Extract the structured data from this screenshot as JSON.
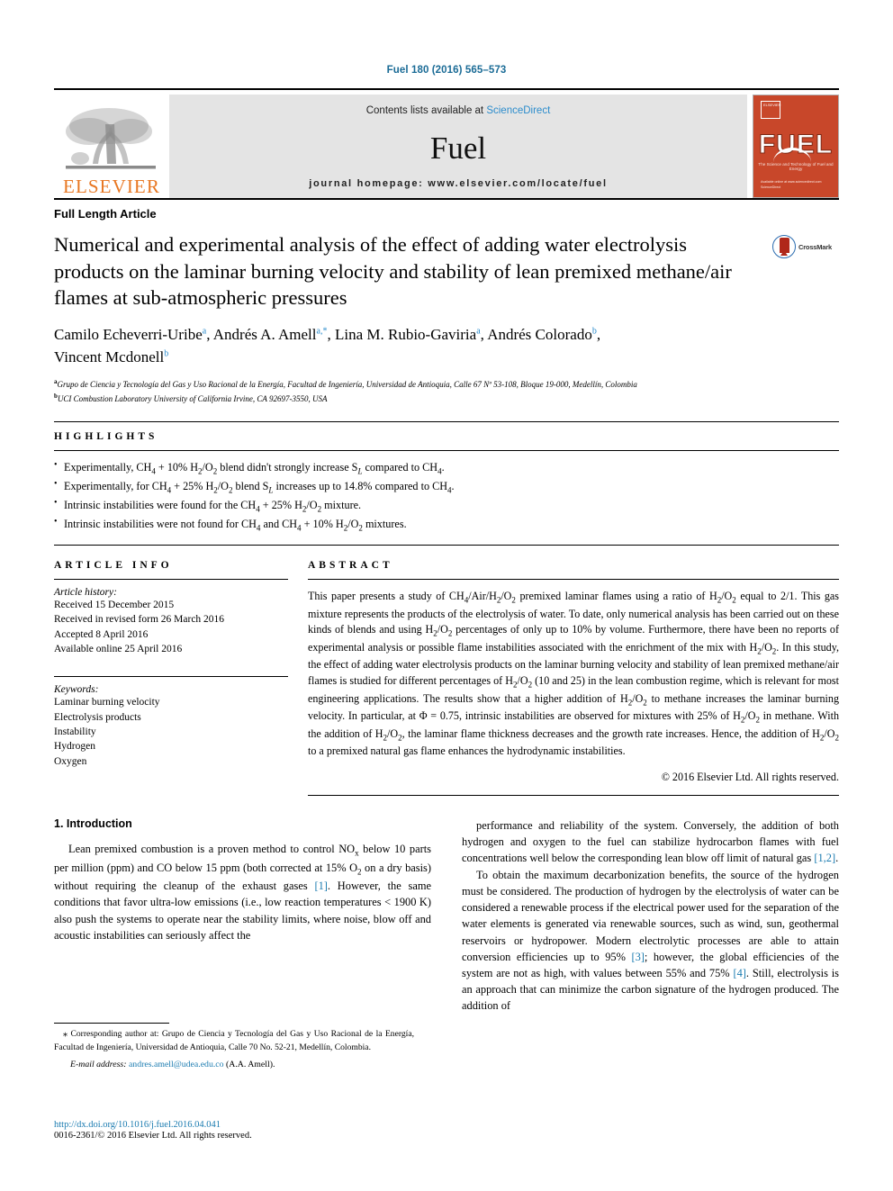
{
  "runhead": "Fuel 180 (2016) 565–573",
  "masthead": {
    "contents_prefix": "Contents lists available at ",
    "contents_link": "ScienceDirect",
    "journal_name": "Fuel",
    "homepage": "journal homepage: www.elsevier.com/locate/fuel",
    "publisher_word": "ELSEVIER",
    "cover_title": "FUEL",
    "cover_subtitle": "The Science and Technology of Fuel and Energy",
    "cover_badge": "ELSEVIER",
    "cover_footer": "Available online at www.sciencedirect.com\nScienceDirect"
  },
  "article": {
    "type": "Full Length Article",
    "title": "Numerical and experimental analysis of the effect of adding water electrolysis products on the laminar burning velocity and stability of lean premixed methane/air flames at sub-atmospheric pressures",
    "crossmark_label": "CrossMark",
    "authors_line1": "Camilo Echeverri-Uribe ",
    "authors": [
      {
        "name": "Camilo Echeverri-Uribe",
        "marks": "a"
      },
      {
        "name": "Andrés A. Amell",
        "marks": "a,*"
      },
      {
        "name": "Lina M. Rubio-Gaviria",
        "marks": "a"
      },
      {
        "name": "Andrés Colorado",
        "marks": "b"
      },
      {
        "name": "Vincent Mcdonell",
        "marks": "b"
      }
    ],
    "affiliations": [
      {
        "mark": "a",
        "text": "Grupo de Ciencia y Tecnología del Gas y Uso Racional de la Energía, Facultad de Ingeniería, Universidad de Antioquia, Calle 67 Nº 53-108, Bloque 19-000, Medellín, Colombia"
      },
      {
        "mark": "b",
        "text": "UCI Combustion Laboratory University of California Irvine, CA 92697-3550, USA"
      }
    ]
  },
  "highlights": {
    "label": "HIGHLIGHTS",
    "items": [
      "Experimentally, CH4 + 10% H2/O2 blend didn't strongly increase SL compared to CH4.",
      "Experimentally, for CH4 + 25% H2/O2 blend SL increases up to 14.8% compared to CH4.",
      "Intrinsic instabilities were found for the CH4 + 25% H2/O2 mixture.",
      "Intrinsic instabilities were not found for CH4 and CH4 + 10% H2/O2 mixtures."
    ]
  },
  "article_info": {
    "label": "ARTICLE INFO",
    "history_title": "Article history:",
    "history": [
      "Received 15 December 2015",
      "Received in revised form 26 March 2016",
      "Accepted 8 April 2016",
      "Available online 25 April 2016"
    ],
    "keywords_title": "Keywords:",
    "keywords": [
      "Laminar burning velocity",
      "Electrolysis products",
      "Instability",
      "Hydrogen",
      "Oxygen"
    ]
  },
  "abstract": {
    "label": "ABSTRACT",
    "text": "This paper presents a study of CH4/Air/H2/O2 premixed laminar flames using a ratio of H2/O2 equal to 2/1. This gas mixture represents the products of the electrolysis of water. To date, only numerical analysis has been carried out on these kinds of blends and using H2/O2 percentages of only up to 10% by volume. Furthermore, there have been no reports of experimental analysis or possible flame instabilities associated with the enrichment of the mix with H2/O2. In this study, the effect of adding water electrolysis products on the laminar burning velocity and stability of lean premixed methane/air flames is studied for different percentages of H2/O2 (10 and 25) in the lean combustion regime, which is relevant for most engineering applications. The results show that a higher addition of H2/O2 to methane increases the laminar burning velocity. In particular, at Φ = 0.75, intrinsic instabilities are observed for mixtures with 25% of H2/O2 in methane. With the addition of H2/O2, the laminar flame thickness decreases and the growth rate increases. Hence, the addition of H2/O2 to a premixed natural gas flame enhances the hydrodynamic instabilities.",
    "copyright": "© 2016 Elsevier Ltd. All rights reserved."
  },
  "body": {
    "section_heading": "1. Introduction",
    "left_paragraph": "Lean premixed combustion is a proven method to control NOx below 10 parts per million (ppm) and CO below 15 ppm (both corrected at 15% O2 on a dry basis) without requiring the cleanup of the exhaust gases [1]. However, the same conditions that favor ultra-low emissions (i.e., low reaction temperatures < 1900 K) also push the systems to operate near the stability limits, where noise, blow off and acoustic instabilities can seriously affect the",
    "right_paragraph_1": "performance and reliability of the system. Conversely, the addition of both hydrogen and oxygen to the fuel can stabilize hydrocarbon flames with fuel concentrations well below the corresponding lean blow off limit of natural gas [1,2].",
    "right_paragraph_2": "To obtain the maximum decarbonization benefits, the source of the hydrogen must be considered. The production of hydrogen by the electrolysis of water can be considered a renewable process if the electrical power used for the separation of the water elements is generated via renewable sources, such as wind, sun, geothermal reservoirs or hydropower. Modern electrolytic processes are able to attain conversion efficiencies up to 95% [3]; however, the global efficiencies of the system are not as high, with values between 55% and 75% [4]. Still, electrolysis is an approach that can minimize the carbon signature of the hydrogen produced. The addition of"
  },
  "footnotes": {
    "corresponding": "Corresponding author at: Grupo de Ciencia y Tecnología del Gas y Uso Racional de la Energía, Facultad de Ingeniería, Universidad de Antioquia, Calle 70 No. 52-21, Medellín, Colombia.",
    "email_label": "E-mail address:",
    "email": "andres.amell@udea.edu.co",
    "email_suffix": "(A.A. Amell).",
    "doi": "http://dx.doi.org/10.1016/j.fuel.2016.04.041",
    "issn": "0016-2361/© 2016 Elsevier Ltd. All rights reserved."
  },
  "colors": {
    "link": "#1a7bb0",
    "sciencedirect": "#2b8ccc",
    "elsevier_orange": "#e87722",
    "cover_red": "#c8472a"
  }
}
